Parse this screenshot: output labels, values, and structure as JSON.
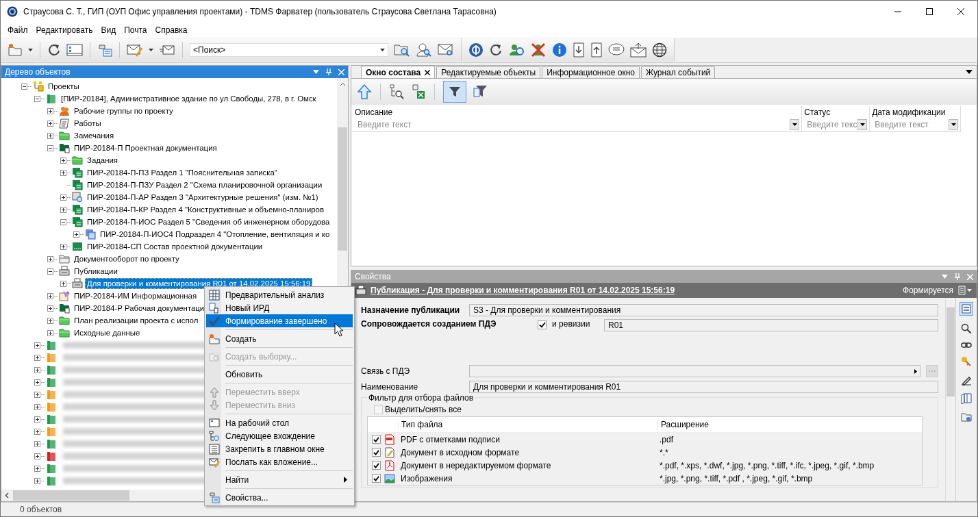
{
  "window": {
    "title": "Страусова С. Т., ГИП (ОУП Офис управления проектами) - TDMS Фарватер (пользователь Страусова Светлана Тарасовна)"
  },
  "menu": [
    "Файл",
    "Редактировать",
    "Вид",
    "Почта",
    "Справка"
  ],
  "toolbar": {
    "search": {
      "value": "<Поиск>"
    }
  },
  "tree_panel": {
    "title": "Дерево объектов",
    "items": [
      {
        "label": "Проекты",
        "kind": "projects",
        "expanded": true,
        "selected": false,
        "children": [
          {
            "label": "[ПИР-20184], Административное здание по ул Свободы, 278, в г. Омск",
            "kind": "binder",
            "color": "#1f9a4a",
            "expanded": true,
            "selected": false,
            "children": [
              {
                "label": "Рабочие группы по проекту",
                "kind": "people",
                "expanded": false,
                "selected": false
              },
              {
                "label": "Работы",
                "kind": "works",
                "expanded": false,
                "selected": false
              },
              {
                "label": "Замечания",
                "kind": "folder",
                "expanded": false,
                "selected": false
              },
              {
                "label": "ПИР-20184-П Проектная документация",
                "kind": "doc-folder",
                "expanded": true,
                "selected": false,
                "children": [
                  {
                    "label": "Задания",
                    "kind": "folder",
                    "expanded": false,
                    "selected": false
                  },
                  {
                    "label": "ПИР-20184-П-ПЗ Раздел 1 \"Пояснительная записка\"",
                    "kind": "section",
                    "expanded": false,
                    "selected": false
                  },
                  {
                    "label": "ПИР-20184-П-ПЗУ Раздел 2 \"Схема планировочной организации",
                    "kind": "section",
                    "selected": false
                  },
                  {
                    "label": "ПИР-20184-П-АР Раздел 3 \"Архитектурные решения\" (изм. №1)",
                    "kind": "review-section",
                    "expanded": false,
                    "selected": false
                  },
                  {
                    "label": "ПИР-20184-П-КР Раздел 4 \"Конструктивные и объемно-планиров",
                    "kind": "section",
                    "expanded": false,
                    "selected": false
                  },
                  {
                    "label": "ПИР-20184-П-ИОС Раздел 5 \"Сведения об инженерном оборудова",
                    "kind": "section",
                    "expanded": true,
                    "selected": false,
                    "children": [
                      {
                        "label": "ПИР-20184-П-ИОС4 Подраздел 4 \"Отопление, вентиляция и ко",
                        "kind": "subsection",
                        "expanded": false,
                        "selected": false
                      }
                    ]
                  },
                  {
                    "label": "ПИР-20184-СП Состав проектной документации",
                    "kind": "list",
                    "expanded": false,
                    "selected": false
                  }
                ]
              },
              {
                "label": "Документооборот по проекту",
                "kind": "grey-folder",
                "expanded": false,
                "selected": false
              },
              {
                "label": "Публикации",
                "kind": "printer",
                "expanded": true,
                "selected": false,
                "children": [
                  {
                    "label": "Для проверки и комментирования R01 от 14.02.2025 15:56:19",
                    "kind": "printer",
                    "expanded": false,
                    "selected": true
                  }
                ]
              },
              {
                "label": "ПИР-20184-ИМ Информационная",
                "kind": "model",
                "expanded": false,
                "selected": false
              },
              {
                "label": "ПИР-20184-Р Рабочая документаци",
                "kind": "doc-folder",
                "expanded": false,
                "selected": false
              },
              {
                "label": "План реализации проекта с испол",
                "kind": "folder",
                "expanded": false,
                "selected": false
              },
              {
                "label": "Исходные данные",
                "kind": "folder",
                "expanded": false,
                "selected": false
              }
            ]
          },
          {
            "kind": "redacted",
            "color": "#1f9a4a",
            "expanded": false,
            "selected": false
          },
          {
            "kind": "redacted",
            "color": "#f39a1e",
            "expanded": false,
            "selected": false
          },
          {
            "kind": "redacted",
            "color": "#1f9a4a",
            "expanded": false,
            "selected": false
          },
          {
            "kind": "redacted",
            "color": "#1f9a4a",
            "expanded": false,
            "selected": false
          },
          {
            "kind": "redacted",
            "color": "#f39a1e",
            "expanded": false,
            "selected": false
          },
          {
            "kind": "redacted",
            "color": "#f39a1e",
            "expanded": false,
            "selected": false
          },
          {
            "kind": "redacted",
            "color": "#1f9a4a",
            "expanded": false,
            "selected": false
          },
          {
            "kind": "redacted",
            "color": "#f39a1e",
            "expanded": false,
            "selected": false
          },
          {
            "kind": "redacted",
            "color": "#1f9a4a",
            "expanded": false,
            "selected": false
          },
          {
            "kind": "redacted",
            "color": "#d42020",
            "expanded": false,
            "selected": false
          },
          {
            "kind": "redacted",
            "color": "#1f9a4a",
            "expanded": false,
            "selected": false
          },
          {
            "kind": "redacted",
            "color": "#1f9a4a",
            "expanded": false,
            "selected": false
          }
        ]
      }
    ]
  },
  "tabs": [
    {
      "label": "Окно состава",
      "selected": true
    },
    {
      "label": "Редактируемые объекты",
      "selected": false
    },
    {
      "label": "Информационное окно",
      "selected": false
    },
    {
      "label": "Журнал событий",
      "selected": false
    }
  ],
  "filter_grid": {
    "columns": [
      {
        "name": "Описание",
        "placeholder": "Введите текст"
      },
      {
        "name": "Статус",
        "placeholder": "Введите текс"
      },
      {
        "name": "Дата модификации",
        "placeholder": "Введите текст"
      }
    ]
  },
  "properties": {
    "title": "Свойства",
    "header": "Публикация - Для проверки и комментирования R01 от 14.02.2025 15:56:19",
    "status": "Формируется",
    "purpose": {
      "label": "Назначение публикации",
      "value": "S3 - Для проверки и комментирования"
    },
    "pde": {
      "label": "Сопровождается созданием ПДЭ",
      "checked": true,
      "revision_label": "и ревизии",
      "revision": "R01"
    },
    "link": {
      "label": "Связь с ПДЭ"
    },
    "name": {
      "label": "Наименование",
      "value": "Для проверки и комментирования R01"
    },
    "filter": {
      "title": "Фильтр для отбора файлов",
      "select_all": {
        "label": "Выделить/снять все",
        "checked": false
      },
      "columns": [
        "Тип файла",
        "Расширение"
      ],
      "rows": [
        {
          "checked": true,
          "kind": "pdf-sign",
          "label": "PDF с отметками подписи",
          "ext": ".pdf"
        },
        {
          "checked": true,
          "kind": "edit",
          "label": "Документ в исходном формате",
          "ext": "*.*"
        },
        {
          "checked": true,
          "kind": "pdf",
          "label": "Документ в нередактируемом формате",
          "ext": "*.pdf, *.xps, *.dwf, *.jpg, *.png, *.tiff, *.ifc,  *.jpeg, *.gif, *.bmp"
        },
        {
          "checked": true,
          "kind": "image",
          "label": "Изображения",
          "ext": "*.jpg, *.png, *.tiff, *.pdf , *.jpeg, *.gif, *.bmp"
        }
      ]
    }
  },
  "context_menu": {
    "groups": [
      [
        {
          "label": "Предварительный анализ",
          "kind": "grid",
          "disabled": false,
          "selected": false,
          "submenu": false
        },
        {
          "label": "Новый ИРД",
          "kind": "doc",
          "disabled": false,
          "selected": false,
          "submenu": false
        },
        {
          "label": "Формирование завершено",
          "kind": "check",
          "disabled": false,
          "selected": true,
          "submenu": false
        }
      ],
      [
        {
          "label": "Создать",
          "kind": "create",
          "disabled": false,
          "selected": false,
          "submenu": false
        }
      ],
      [
        {
          "label": "Создать выборку...",
          "kind": "selection",
          "disabled": true,
          "selected": false,
          "submenu": false
        }
      ],
      [
        {
          "label": "Обновить",
          "kind": "none",
          "disabled": false,
          "selected": false,
          "submenu": false
        }
      ],
      [
        {
          "label": "Переместить вверх",
          "kind": "up",
          "disabled": true,
          "selected": false,
          "submenu": false
        },
        {
          "label": "Переместить вниз",
          "kind": "down",
          "disabled": true,
          "selected": false,
          "submenu": false
        }
      ],
      [
        {
          "label": "На рабочий стол",
          "kind": "desktop",
          "disabled": false,
          "selected": false,
          "submenu": false
        },
        {
          "label": "Следующее вхождение",
          "kind": "next",
          "disabled": false,
          "selected": false,
          "submenu": false
        },
        {
          "label": "Закрепить в главном окне",
          "kind": "pin",
          "disabled": false,
          "selected": false,
          "submenu": false
        },
        {
          "label": "Послать как вложение...",
          "kind": "mail",
          "disabled": false,
          "selected": false,
          "submenu": false
        }
      ],
      [
        {
          "label": "Найти",
          "kind": "none",
          "disabled": false,
          "selected": false,
          "submenu": true
        }
      ],
      [
        {
          "label": "Свойства...",
          "kind": "properties",
          "disabled": false,
          "selected": false,
          "submenu": false
        }
      ]
    ]
  },
  "status_bar": {
    "text": "0 объектов"
  }
}
